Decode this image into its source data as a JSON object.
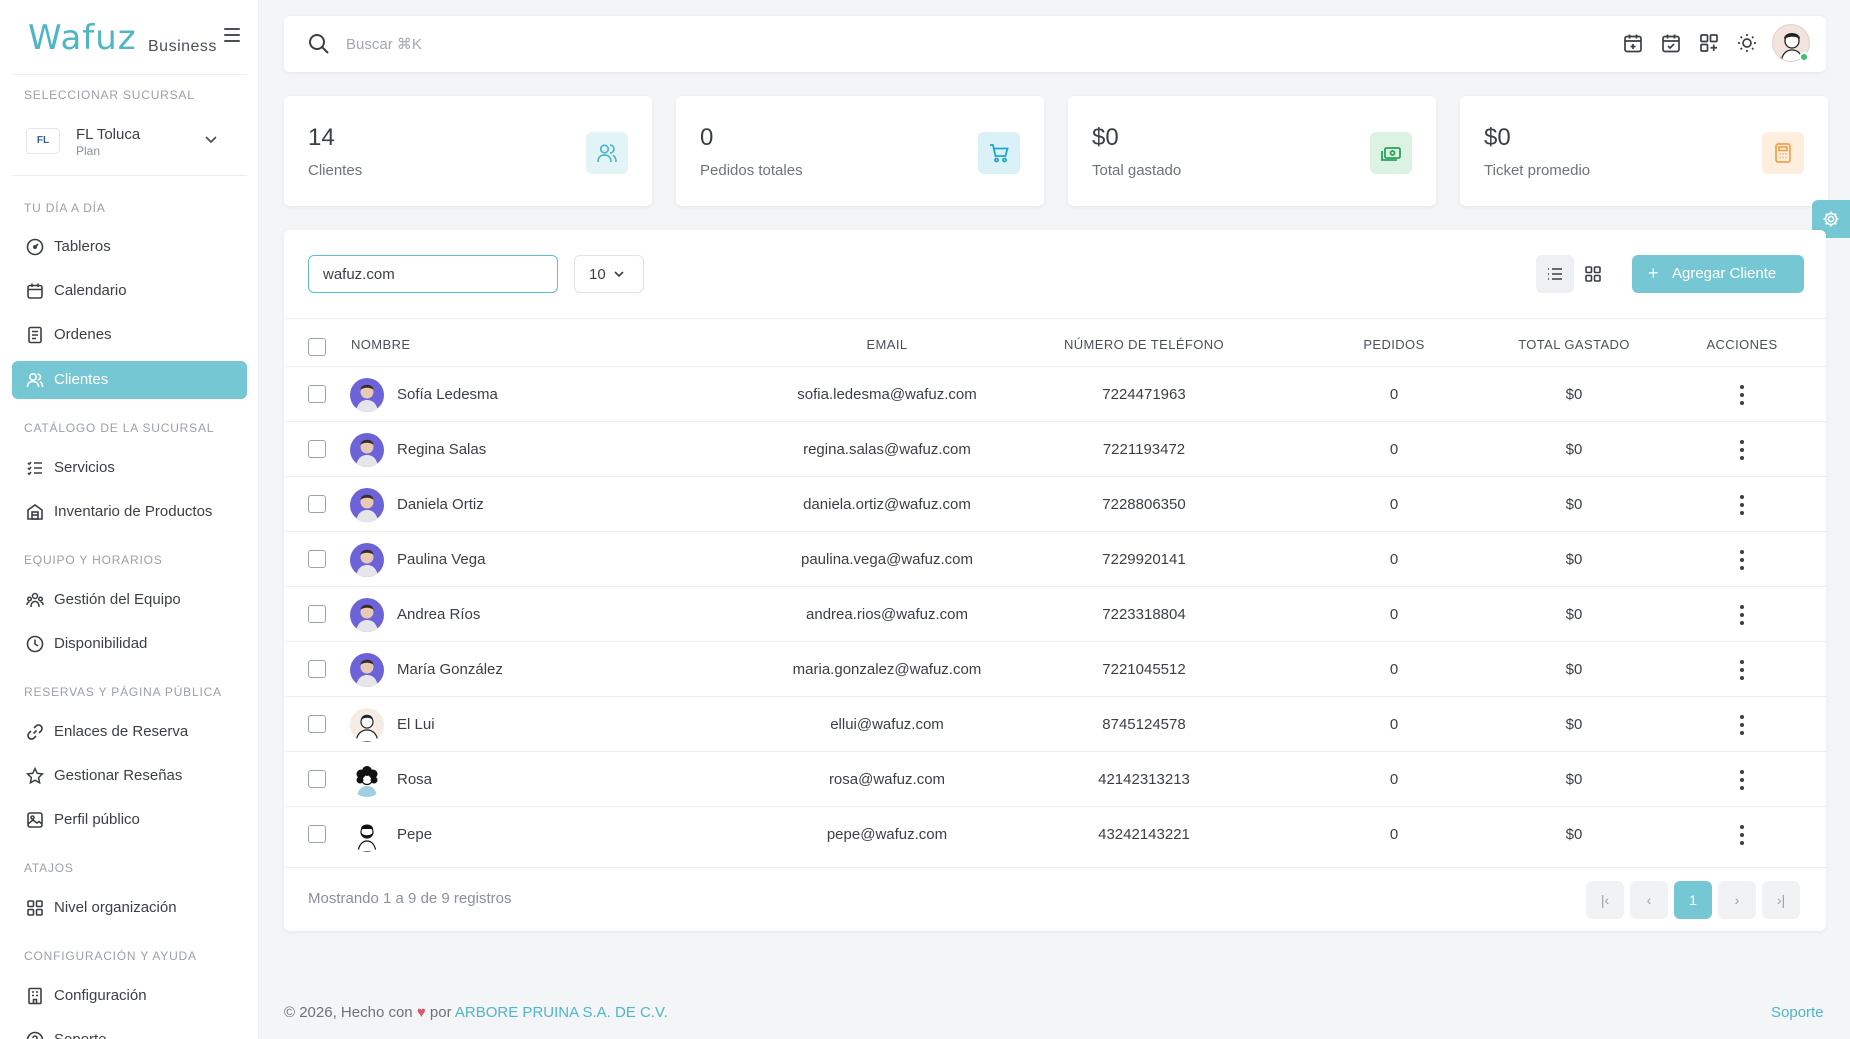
{
  "brand": {
    "logo": "Wafuz",
    "subtitle": "Business"
  },
  "sidebar": {
    "branch_section": "SELECCIONAR SUCURSAL",
    "branch": {
      "logo_text": "FL",
      "name": "FL Toluca",
      "plan": "Plan"
    },
    "sections": [
      {
        "title": "TU DÍA A DÍA",
        "items": [
          {
            "label": "Tableros",
            "icon": "dashboard-icon"
          },
          {
            "label": "Calendario",
            "icon": "calendar-icon"
          },
          {
            "label": "Ordenes",
            "icon": "receipt-icon"
          },
          {
            "label": "Clientes",
            "icon": "users-icon",
            "active": true
          }
        ]
      },
      {
        "title": "CATÁLOGO DE LA SUCURSAL",
        "items": [
          {
            "label": "Servicios",
            "icon": "list-icon"
          },
          {
            "label": "Inventario de Productos",
            "icon": "store-icon"
          }
        ]
      },
      {
        "title": "EQUIPO Y HORARIOS",
        "items": [
          {
            "label": "Gestión del Equipo",
            "icon": "team-icon"
          },
          {
            "label": "Disponibilidad",
            "icon": "clock-icon"
          }
        ]
      },
      {
        "title": "RESERVAS Y PÁGINA PÚBLICA",
        "items": [
          {
            "label": "Enlaces de Reserva",
            "icon": "link-icon"
          },
          {
            "label": "Gestionar Reseñas",
            "icon": "star-icon"
          },
          {
            "label": "Perfil público",
            "icon": "image-icon"
          }
        ]
      },
      {
        "title": "ATAJOS",
        "items": [
          {
            "label": "Nivel organización",
            "icon": "grid-icon"
          }
        ]
      },
      {
        "title": "CONFIGURACIÓN Y AYUDA",
        "items": [
          {
            "label": "Configuración",
            "icon": "building-icon"
          },
          {
            "label": "Soporte",
            "icon": "help-icon"
          }
        ]
      }
    ]
  },
  "search": {
    "placeholder": "Buscar ⌘K",
    "value": ""
  },
  "stats": [
    {
      "value": "14",
      "label": "Clientes",
      "icon": "users-icon",
      "color": "#4fb6c7",
      "bg": "#e3f4f7"
    },
    {
      "value": "0",
      "label": "Pedidos totales",
      "icon": "cart-icon",
      "color": "#1aa9c9",
      "bg": "#d9f1f7"
    },
    {
      "value": "$0",
      "label": "Total gastado",
      "icon": "cash-icon",
      "color": "#27a35a",
      "bg": "#dcf3e4"
    },
    {
      "value": "$0",
      "label": "Ticket promedio",
      "icon": "calculator-icon",
      "color": "#f0a04b",
      "bg": "#fdeedd"
    }
  ],
  "toolbar": {
    "filter_value": "wafuz.com",
    "page_size": "10",
    "add_label": "Agregar Cliente"
  },
  "table": {
    "columns": [
      "NOMBRE",
      "EMAIL",
      "NÚMERO DE TELÉFONO",
      "PEDIDOS",
      "TOTAL GASTADO",
      "ACCIONES"
    ],
    "rows": [
      {
        "name": "Sofía Ledesma",
        "email": "sofia.ledesma@wafuz.com",
        "phone": "7224471963",
        "orders": "0",
        "spent": "$0",
        "avatar": "photo"
      },
      {
        "name": "Regina Salas",
        "email": "regina.salas@wafuz.com",
        "phone": "7221193472",
        "orders": "0",
        "spent": "$0",
        "avatar": "photo"
      },
      {
        "name": "Daniela Ortiz",
        "email": "daniela.ortiz@wafuz.com",
        "phone": "7228806350",
        "orders": "0",
        "spent": "$0",
        "avatar": "photo"
      },
      {
        "name": "Paulina Vega",
        "email": "paulina.vega@wafuz.com",
        "phone": "7229920141",
        "orders": "0",
        "spent": "$0",
        "avatar": "photo"
      },
      {
        "name": "Andrea Ríos",
        "email": "andrea.rios@wafuz.com",
        "phone": "7223318804",
        "orders": "0",
        "spent": "$0",
        "avatar": "photo"
      },
      {
        "name": "María González",
        "email": "maria.gonzalez@wafuz.com",
        "phone": "7221045512",
        "orders": "0",
        "spent": "$0",
        "avatar": "photo"
      },
      {
        "name": "El Lui",
        "email": "ellui@wafuz.com",
        "phone": "8745124578",
        "orders": "0",
        "spent": "$0",
        "avatar": "sketch"
      },
      {
        "name": "Rosa",
        "email": "rosa@wafuz.com",
        "phone": "42142313213",
        "orders": "0",
        "spent": "$0",
        "avatar": "curly"
      },
      {
        "name": "Pepe",
        "email": "pepe@wafuz.com",
        "phone": "43242143221",
        "orders": "0",
        "spent": "$0",
        "avatar": "beard"
      }
    ],
    "footer": "Mostrando 1 a 9 de 9 registros",
    "pagination": {
      "first": "|‹",
      "prev": "‹",
      "current": "1",
      "next": "›",
      "last": "›|"
    }
  },
  "footer": {
    "prefix": "© 2026, Hecho con",
    "heart": "♥",
    "by": "por",
    "company": "ARBORE PRUINA S.A. DE C.V.",
    "support": "Soporte"
  }
}
